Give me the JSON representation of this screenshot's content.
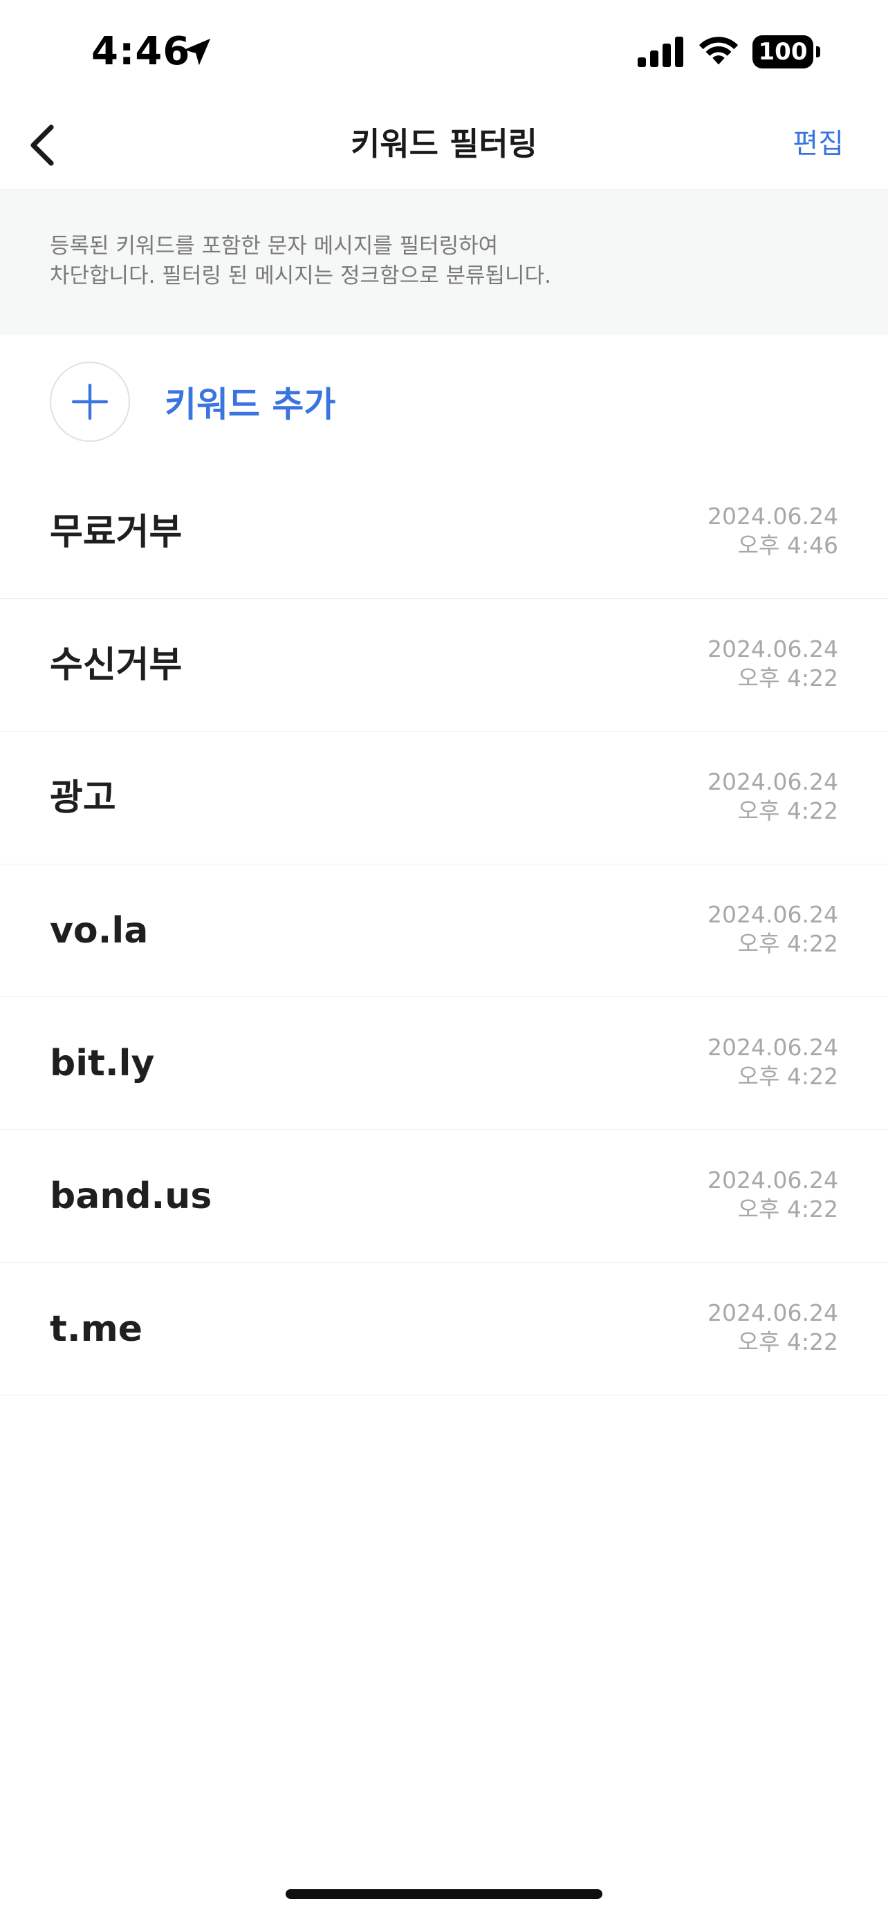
{
  "status_bar": {
    "time": "4:46",
    "battery": "100",
    "icons": [
      "location-arrow-icon",
      "cellular-signal-icon",
      "wifi-icon",
      "battery-icon"
    ]
  },
  "nav": {
    "back_icon": "chevron-left-icon",
    "title": "키워드 필터링",
    "edit_label": "편집"
  },
  "info": {
    "text": "등록된 키워드를 포함한 문자 메시지를 필터링하여\n차단합니다. 필터링 된 메시지는 정크함으로 분류됩니다."
  },
  "add_keyword": {
    "icon": "plus-icon",
    "label": "키워드 추가"
  },
  "keywords": [
    {
      "text": "무료거부",
      "date": "2024.06.24",
      "time": "오후 4:46"
    },
    {
      "text": "수신거부",
      "date": "2024.06.24",
      "time": "오후 4:22"
    },
    {
      "text": "광고",
      "date": "2024.06.24",
      "time": "오후 4:22"
    },
    {
      "text": "vo.la",
      "date": "2024.06.24",
      "time": "오후 4:22"
    },
    {
      "text": "bit.ly",
      "date": "2024.06.24",
      "time": "오후 4:22"
    },
    {
      "text": "band.us",
      "date": "2024.06.24",
      "time": "오후 4:22"
    },
    {
      "text": "t.me",
      "date": "2024.06.24",
      "time": "오후 4:22"
    }
  ],
  "colors": {
    "accent": "#3a74e0",
    "banner_bg": "#f6f7f7",
    "date_text": "#a8a8a8"
  }
}
